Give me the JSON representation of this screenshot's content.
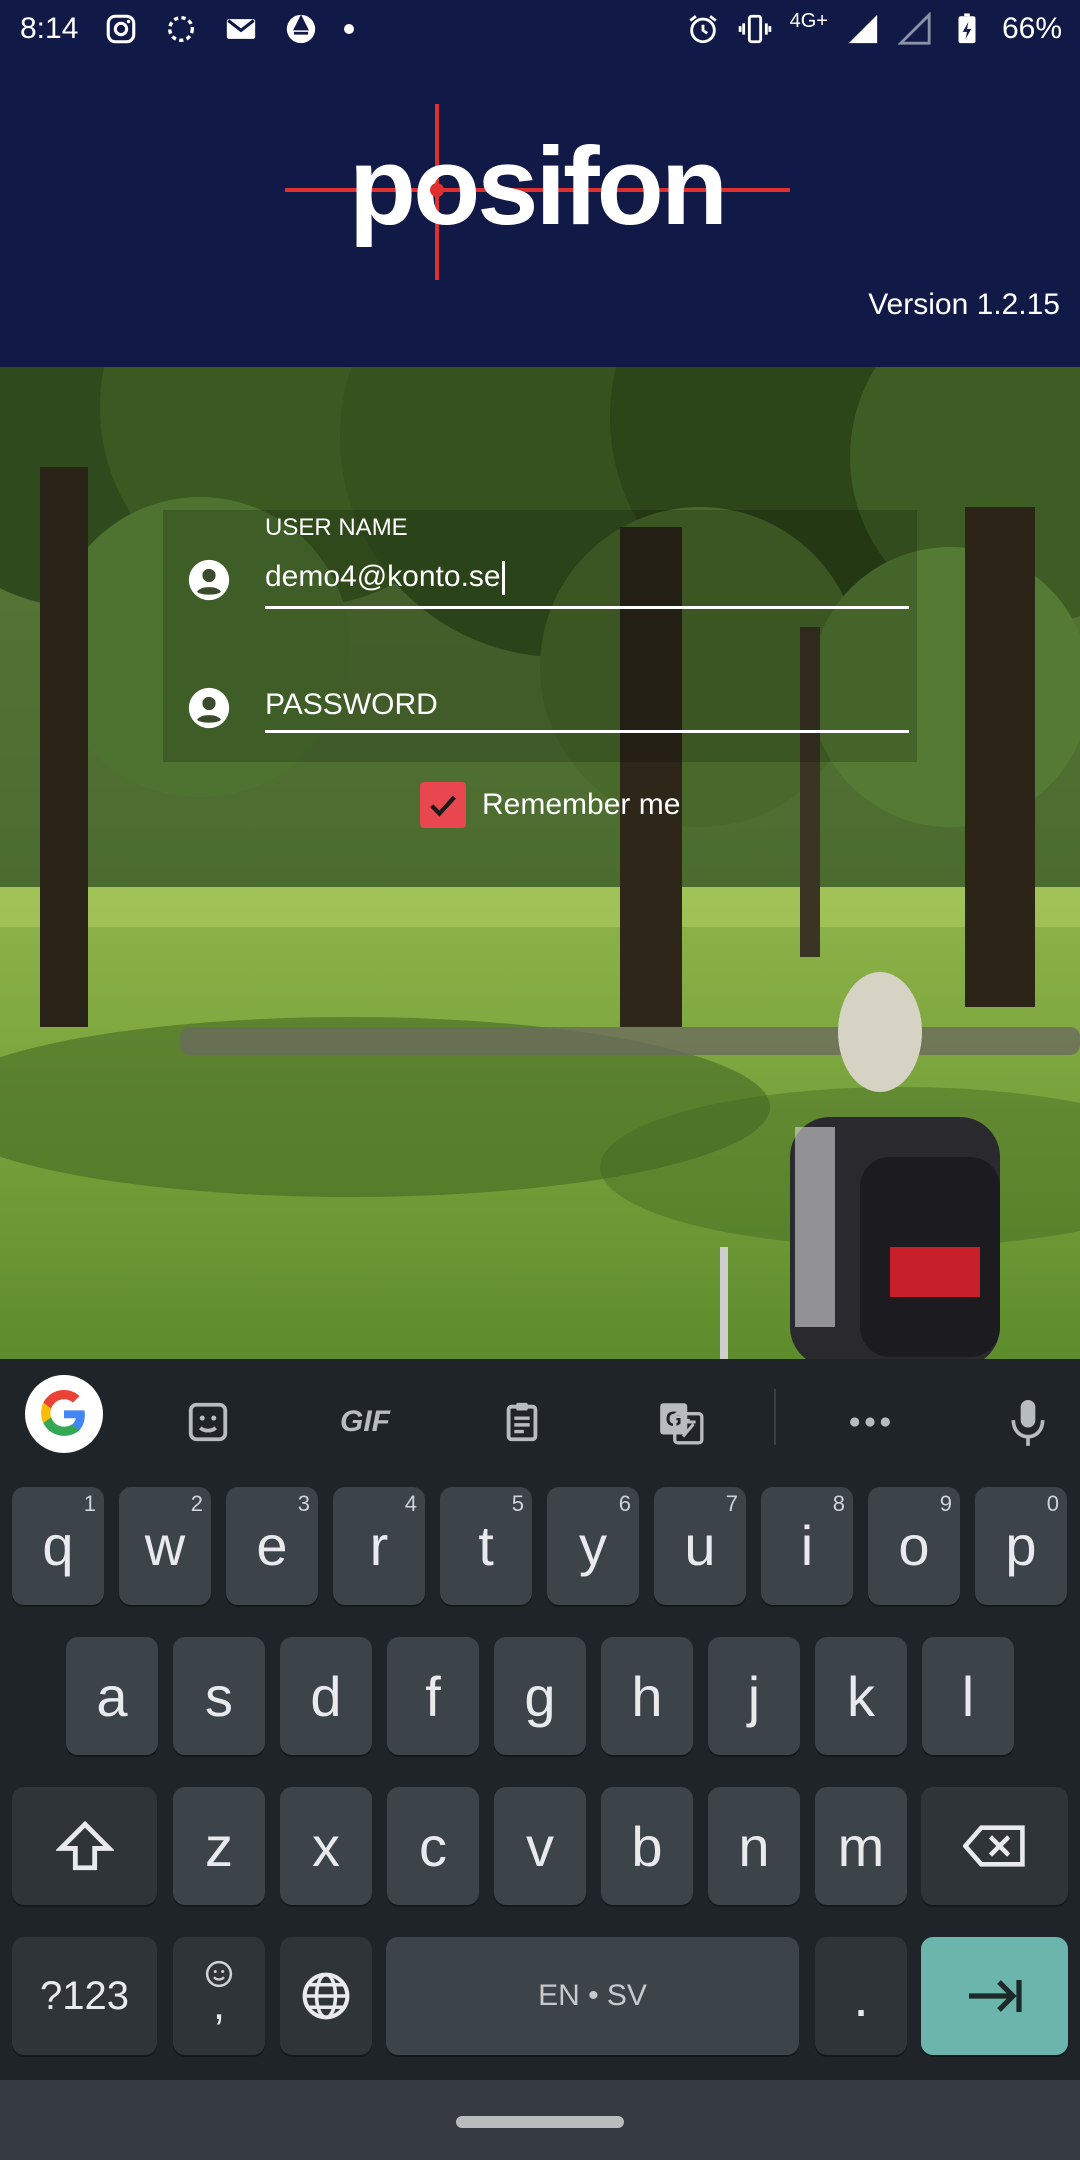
{
  "status_bar": {
    "time": "8:14",
    "network": "4G+",
    "battery": "66%"
  },
  "header": {
    "logo_text": "posifon",
    "version": "Version 1.2.15"
  },
  "login": {
    "username_label": "USER NAME",
    "username_value": "demo4@konto.se",
    "password_placeholder": "PASSWORD",
    "remember_label": "Remember me",
    "remember_checked": true
  },
  "keyboard": {
    "toolbar": [
      "google-icon",
      "sticker-icon",
      "GIF",
      "clipboard-icon",
      "translate-icon",
      "more-icon",
      "mic-icon"
    ],
    "gif_label": "GIF",
    "row1": [
      {
        "k": "q",
        "n": "1"
      },
      {
        "k": "w",
        "n": "2"
      },
      {
        "k": "e",
        "n": "3"
      },
      {
        "k": "r",
        "n": "4"
      },
      {
        "k": "t",
        "n": "5"
      },
      {
        "k": "y",
        "n": "6"
      },
      {
        "k": "u",
        "n": "7"
      },
      {
        "k": "i",
        "n": "8"
      },
      {
        "k": "o",
        "n": "9"
      },
      {
        "k": "p",
        "n": "0"
      }
    ],
    "row2": [
      "a",
      "s",
      "d",
      "f",
      "g",
      "h",
      "j",
      "k",
      "l"
    ],
    "row3": [
      "z",
      "x",
      "c",
      "v",
      "b",
      "n",
      "m"
    ],
    "symbols_label": "?123",
    "comma_label": ",",
    "space_label": "EN • SV",
    "period_label": "."
  },
  "colors": {
    "header_bg": "#111a47",
    "accent_red": "#e8474f",
    "keyboard_bg": "#1f2428",
    "key_bg": "#3c4349",
    "enter_bg": "#6bb5ad"
  }
}
